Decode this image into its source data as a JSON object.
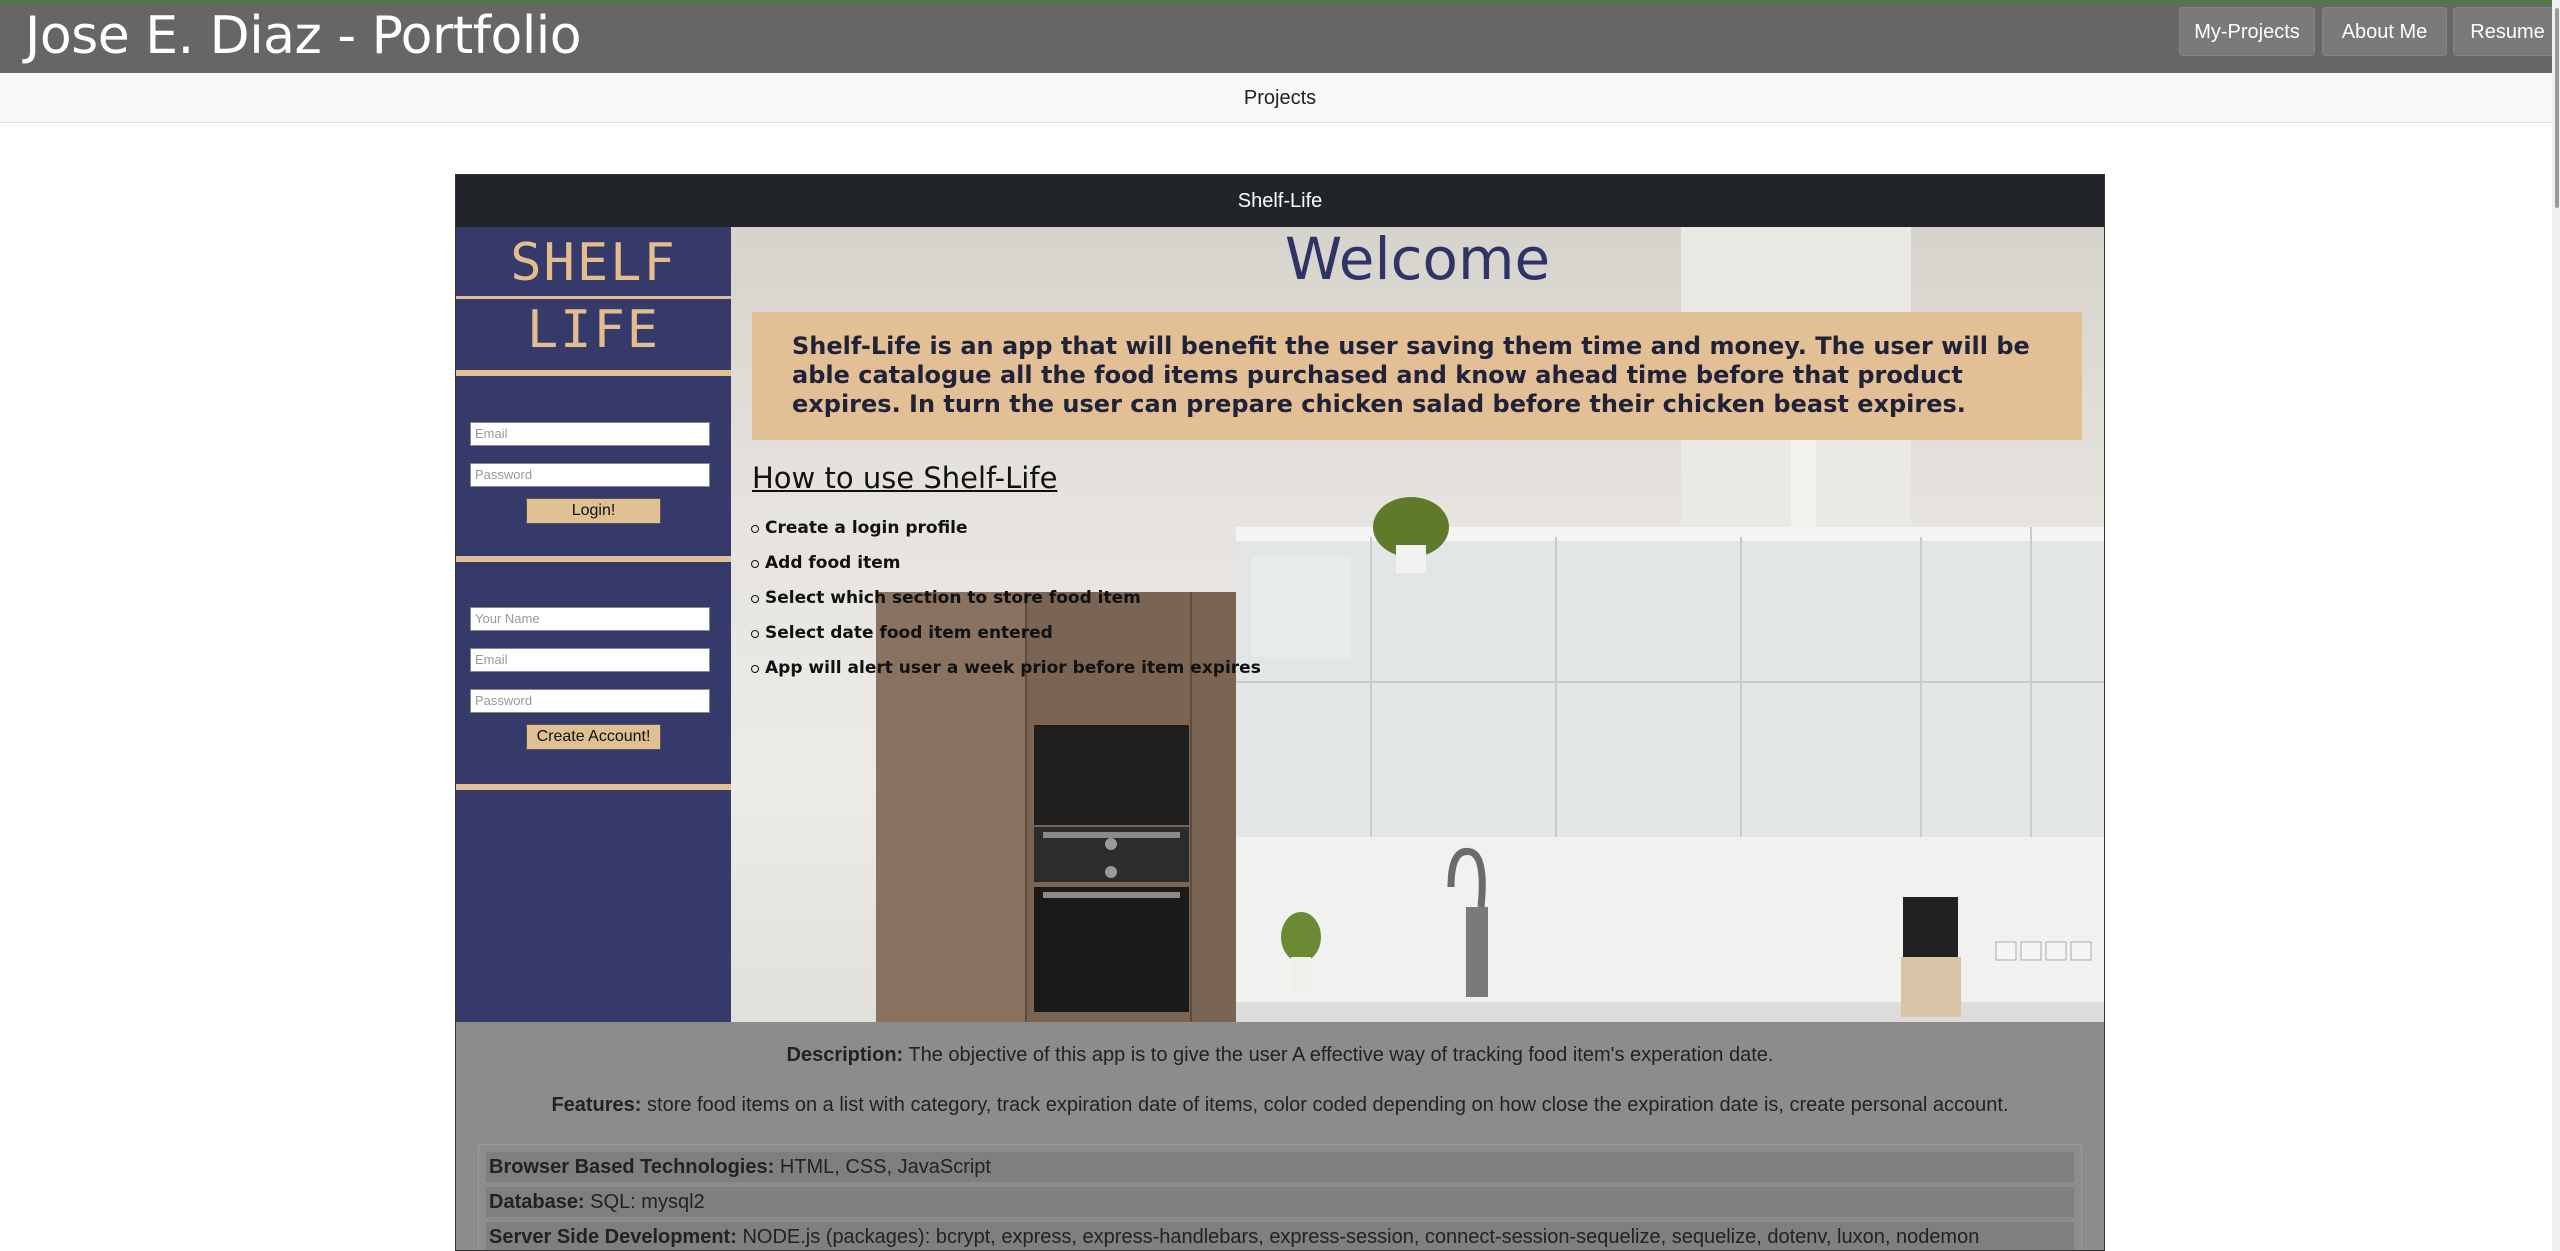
{
  "header": {
    "title": "Jose E. Diaz - Portfolio",
    "nav": [
      "My-Projects",
      "About Me",
      "Resume"
    ]
  },
  "subnav": {
    "label": "Projects"
  },
  "project": {
    "title": "Shelf-Life",
    "app": {
      "logo_line1": "SHELF",
      "logo_line2": "LIFE",
      "login": {
        "email_placeholder": "Email",
        "password_placeholder": "Password",
        "button": "Login!"
      },
      "signup": {
        "name_placeholder": "Your Name",
        "email_placeholder": "Email",
        "password_placeholder": "Password",
        "button": "Create Account!"
      },
      "welcome": "Welcome",
      "intro": "Shelf-Life is an app that will benefit the user saving them time and money. The user will be able catalogue all the food items purchased and know ahead time before that product expires. In turn the user can prepare chicken salad before their chicken beast expires.",
      "howto_title": "How to use Shelf-Life",
      "steps": [
        "Create a login profile",
        "Add food item",
        "Select which section to store food item",
        "Select date food item entered",
        "App will alert user a week prior before item expires"
      ]
    },
    "description_label": "Description:",
    "description": "The objective of this app is to give the user A effective way of tracking food item's experation date.",
    "features_label": "Features:",
    "features": "store food items on a list with category, track expiration date of items, color coded depending on how close the expiration date is, create personal account.",
    "tech": [
      {
        "label": "Browser Based Technologies:",
        "value": "HTML, CSS, JavaScript"
      },
      {
        "label": "Database:",
        "value": "SQL: mysql2"
      },
      {
        "label": "Server Side Development:",
        "value": "NODE.js (packages): bcrypt, express, express-handlebars, express-session, connect-session-sequelize, sequelize, dotenv, luxon, nodemon"
      }
    ]
  },
  "colors": {
    "topbar": "#666666",
    "sidebar": "#363a6a",
    "accent": "#e0bf92",
    "card_header": "#212529"
  }
}
